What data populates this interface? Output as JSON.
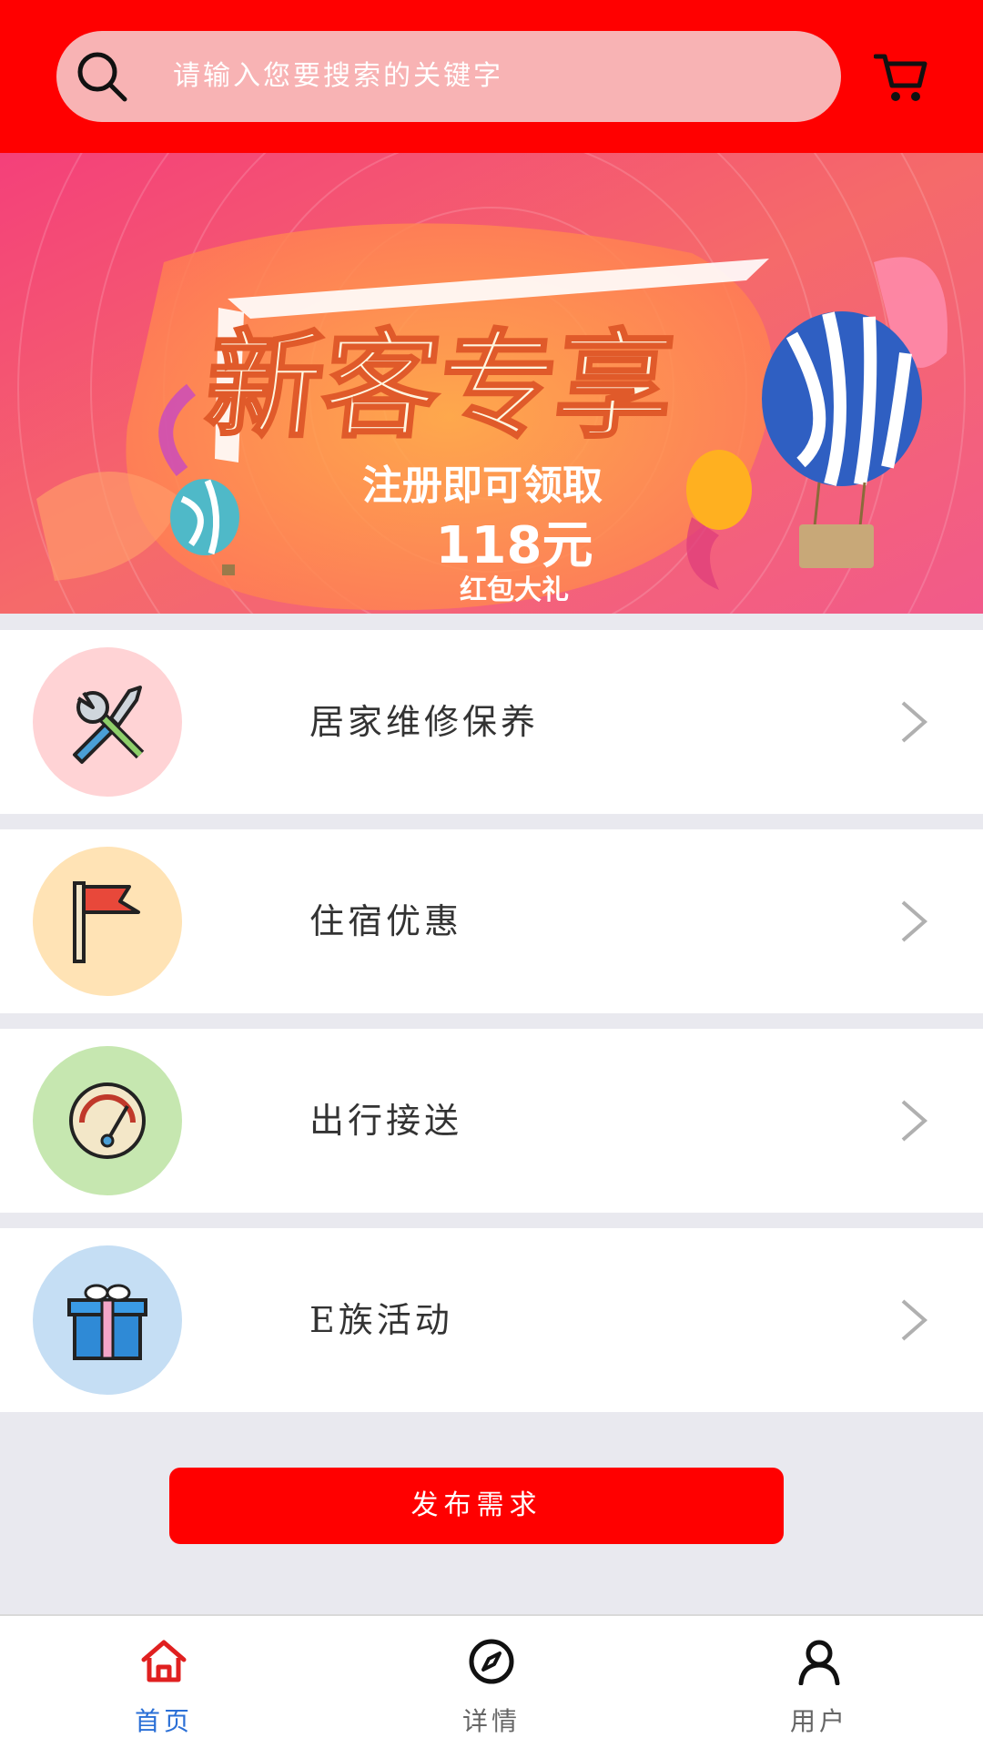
{
  "header": {
    "search_placeholder": "请输入您要搜索的关键字",
    "icons": {
      "search": "search-icon",
      "cart": "cart-icon"
    }
  },
  "banner": {
    "headline": "新客专享",
    "subline": "注册即可领取",
    "amount": "118元",
    "caption": "红包大礼"
  },
  "services": [
    {
      "label": "居家维修保养",
      "icon": "tools-icon",
      "circle_color": "#ffd3d5"
    },
    {
      "label": "住宿优惠",
      "icon": "flag-icon",
      "circle_color": "#ffe3b5"
    },
    {
      "label": "出行接送",
      "icon": "gauge-icon",
      "circle_color": "#c6e7b0"
    },
    {
      "label": "E族活动",
      "icon": "gift-icon",
      "circle_color": "#c5def4"
    }
  ],
  "publish_button": {
    "label": "发布需求"
  },
  "tabbar": {
    "tabs": [
      {
        "label": "首页",
        "icon": "home-icon",
        "active": true
      },
      {
        "label": "详情",
        "icon": "compass-icon",
        "active": false
      },
      {
        "label": "用户",
        "icon": "user-icon",
        "active": false
      }
    ]
  },
  "colors": {
    "brand_red": "#ff0000",
    "active_tab": "#2a6fd6",
    "inactive_tab": "#666666"
  }
}
